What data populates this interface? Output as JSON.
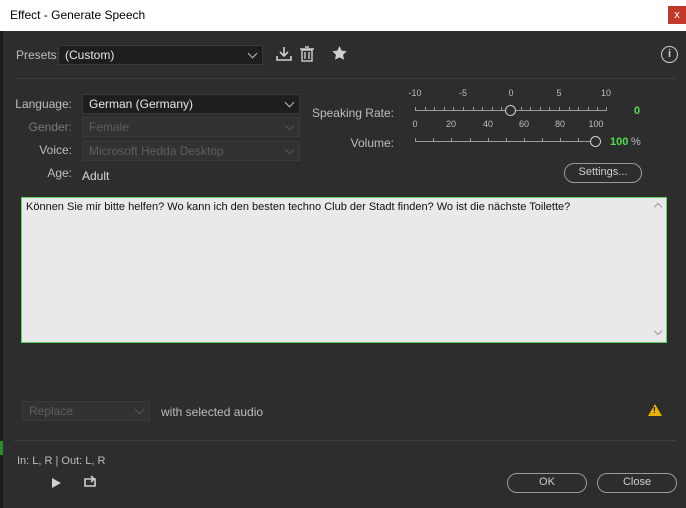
{
  "window": {
    "title": "Effect - Generate Speech",
    "close_glyph": "x"
  },
  "presets": {
    "label": "Presets:",
    "value": "(Custom)"
  },
  "icons": {
    "info": "i"
  },
  "language": {
    "label": "Language:",
    "value": "German (Germany)"
  },
  "gender": {
    "label": "Gender:",
    "value": "Female"
  },
  "voice": {
    "label": "Voice:",
    "value": "Microsoft Hedda Desktop"
  },
  "age": {
    "label": "Age:",
    "value": "Adult"
  },
  "speaking_rate": {
    "label": "Speaking Rate:",
    "ticks": [
      "-10",
      "-5",
      "0",
      "5",
      "10"
    ],
    "value": "0"
  },
  "volume": {
    "label": "Volume:",
    "ticks": [
      "0",
      "20",
      "40",
      "60",
      "80",
      "100"
    ],
    "value": "100",
    "unit": "%"
  },
  "settings_button": "Settings...",
  "text": "Können Sie mir bitte helfen? Wo kann ich den besten techno Club der Stadt finden? Wo ist die nächste Toilette?",
  "replace": {
    "value": "Replace",
    "suffix": "with selected audio"
  },
  "io": "In: L, R | Out: L, R",
  "ok_label": "OK",
  "close_label": "Close"
}
